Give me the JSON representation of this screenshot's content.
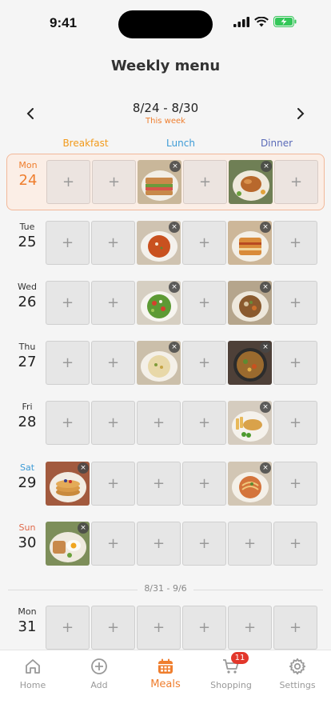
{
  "status": {
    "time": "9:41"
  },
  "header": {
    "title": "Weekly menu",
    "range": "8/24 - 8/30",
    "range_sub": "This week"
  },
  "meals": {
    "breakfast": "Breakfast",
    "lunch": "Lunch",
    "dinner": "Dinner"
  },
  "add_symbol": "+",
  "remove_symbol": "×",
  "days": [
    {
      "dow": "Mon",
      "num": "24",
      "today": true,
      "slots": [
        null,
        null,
        "sandwich",
        null,
        "roast-chicken",
        null
      ]
    },
    {
      "dow": "Tue",
      "num": "25",
      "slots": [
        null,
        null,
        "tomato-soup",
        null,
        "lasagna",
        null
      ]
    },
    {
      "dow": "Wed",
      "num": "26",
      "slots": [
        null,
        null,
        "salad",
        null,
        "stew",
        null
      ]
    },
    {
      "dow": "Thu",
      "num": "27",
      "slots": [
        null,
        null,
        "porridge",
        null,
        "skillet",
        null
      ]
    },
    {
      "dow": "Fri",
      "num": "28",
      "slots": [
        null,
        null,
        null,
        null,
        "fish-and-chips",
        null
      ]
    },
    {
      "dow": "Sat",
      "num": "29",
      "slots": [
        "pancakes",
        null,
        null,
        null,
        "pasta",
        null
      ]
    },
    {
      "dow": "Sun",
      "num": "30",
      "slots": [
        "eggs-toast",
        null,
        null,
        null,
        null,
        null
      ]
    }
  ],
  "next_week": {
    "label": "8/31 - 9/6",
    "day": {
      "dow": "Mon",
      "num": "31"
    }
  },
  "tabs": [
    {
      "label": "Home",
      "icon": "home-icon"
    },
    {
      "label": "Add",
      "icon": "add-circle-icon"
    },
    {
      "label": "Meals",
      "icon": "calendar-icon",
      "active": true
    },
    {
      "label": "Shopping",
      "icon": "cart-icon",
      "badge": "11"
    },
    {
      "label": "Settings",
      "icon": "gear-icon"
    }
  ],
  "colors": {
    "accent": "#ef7e2e",
    "breakfast": "#f29a1b",
    "lunch": "#3d9bd6",
    "dinner": "#5a6ab8",
    "badge": "#e2372b"
  }
}
